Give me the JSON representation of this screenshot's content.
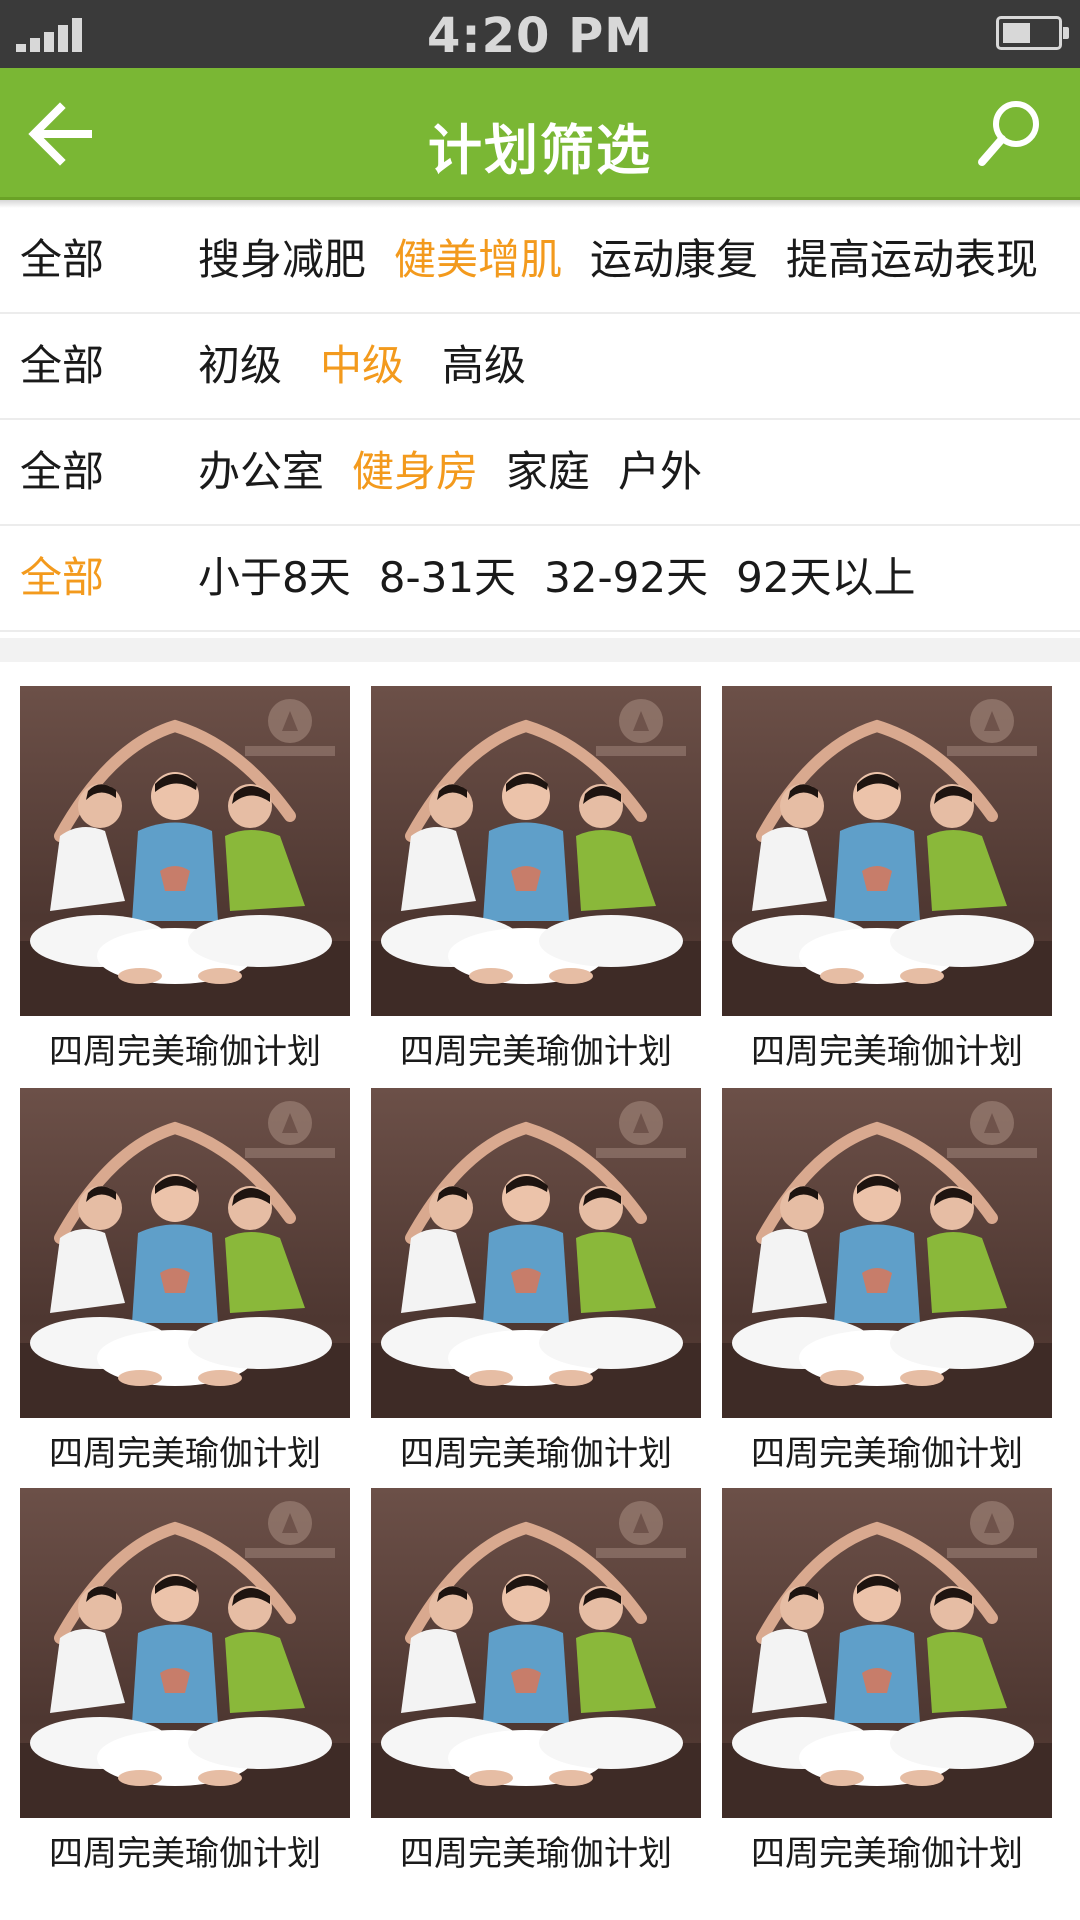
{
  "status_bar": {
    "time": "4:20 PM",
    "signal_icon": "signal-bars-icon",
    "battery_icon": "battery-icon",
    "battery_level": 0.5
  },
  "header": {
    "title": "计划筛选",
    "back_icon": "arrow-left-icon",
    "search_icon": "search-icon",
    "color": "#7ab734"
  },
  "colors": {
    "active": "#f39a1d",
    "text": "#1a1a1a",
    "divider": "#ececec"
  },
  "filters": [
    {
      "all_label": "全部",
      "all_active": false,
      "options": [
        {
          "label": "搜身减肥",
          "active": false
        },
        {
          "label": "健美增肌",
          "active": true
        },
        {
          "label": "运动康复",
          "active": false
        },
        {
          "label": "提高运动表现",
          "active": false
        }
      ]
    },
    {
      "all_label": "全部",
      "all_active": false,
      "options": [
        {
          "label": "初级",
          "active": false
        },
        {
          "label": "中级",
          "active": true
        },
        {
          "label": "高级",
          "active": false
        }
      ]
    },
    {
      "all_label": "全部",
      "all_active": false,
      "options": [
        {
          "label": "办公室",
          "active": false
        },
        {
          "label": "健身房",
          "active": true
        },
        {
          "label": "家庭",
          "active": false
        },
        {
          "label": "户外",
          "active": false
        }
      ]
    },
    {
      "all_label": "全部",
      "all_active": true,
      "options": [
        {
          "label": "小于8天",
          "active": false
        },
        {
          "label": "8-31天",
          "active": false
        },
        {
          "label": "32-92天",
          "active": false
        },
        {
          "label": "92天以上",
          "active": false
        }
      ]
    }
  ],
  "plans": [
    {
      "title": "四周完美瑜伽计划"
    },
    {
      "title": "四周完美瑜伽计划"
    },
    {
      "title": "四周完美瑜伽计划"
    },
    {
      "title": "四周完美瑜伽计划"
    },
    {
      "title": "四周完美瑜伽计划"
    },
    {
      "title": "四周完美瑜伽计划"
    },
    {
      "title": "四周完美瑜伽计划"
    },
    {
      "title": "四周完美瑜伽计划"
    },
    {
      "title": "四周完美瑜伽计划"
    }
  ]
}
